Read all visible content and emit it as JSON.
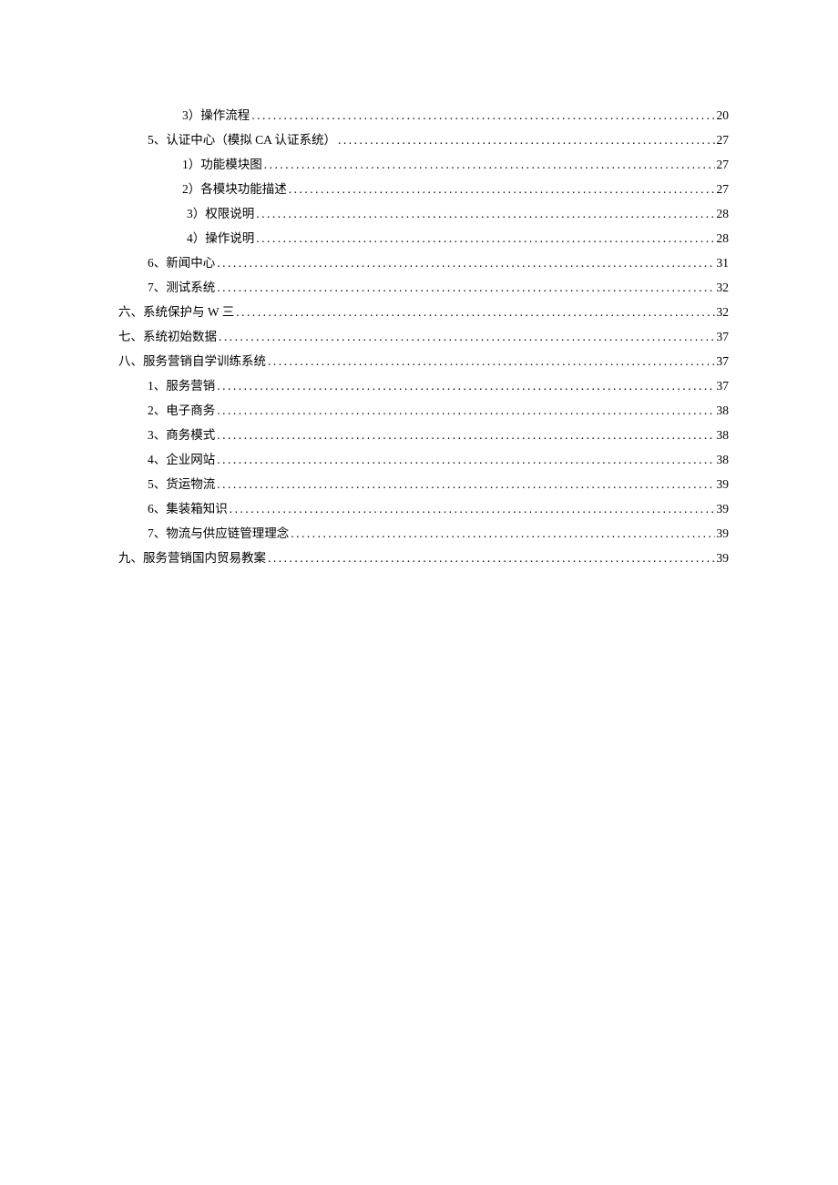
{
  "entries": [
    {
      "indent": "indent-2",
      "label": "3）操作流程",
      "page": "20"
    },
    {
      "indent": "indent-1",
      "label": "5、认证中心（模拟 CA 认证系统）",
      "page": "27"
    },
    {
      "indent": "indent-2",
      "label": "1）功能模块图",
      "page": "27"
    },
    {
      "indent": "indent-2",
      "label": "2）各模块功能描述",
      "page": "27"
    },
    {
      "indent": "indent-2b",
      "label": "3）权限说明",
      "page": "28"
    },
    {
      "indent": "indent-2b",
      "label": "4）操作说明",
      "page": "28"
    },
    {
      "indent": "indent-1",
      "label": "6、新闻中心",
      "page": "31"
    },
    {
      "indent": "indent-1",
      "label": "7、测试系统",
      "page": "32"
    },
    {
      "indent": "indent-0",
      "label": "六、系统保护与 W 三",
      "page": "32"
    },
    {
      "indent": "indent-0",
      "label": "七、系统初始数据",
      "page": "37"
    },
    {
      "indent": "indent-0",
      "label": "八、服务营销自学训练系统",
      "page": "37"
    },
    {
      "indent": "indent-1",
      "label": "1、服务营销",
      "page": "37"
    },
    {
      "indent": "indent-1",
      "label": "2、电子商务",
      "page": "38"
    },
    {
      "indent": "indent-1",
      "label": "3、商务模式",
      "page": "38"
    },
    {
      "indent": "indent-1",
      "label": "4、企业网站",
      "page": "38"
    },
    {
      "indent": "indent-1",
      "label": "5、货运物流",
      "page": "39"
    },
    {
      "indent": "indent-1",
      "label": "6、集装箱知识",
      "page": "39"
    },
    {
      "indent": "indent-1",
      "label": "7、物流与供应链管理理念",
      "page": "39"
    },
    {
      "indent": "indent-0",
      "label": "九、服务营销国内贸易教案",
      "page": "39"
    }
  ],
  "leader": "......................................................................................................................................................"
}
